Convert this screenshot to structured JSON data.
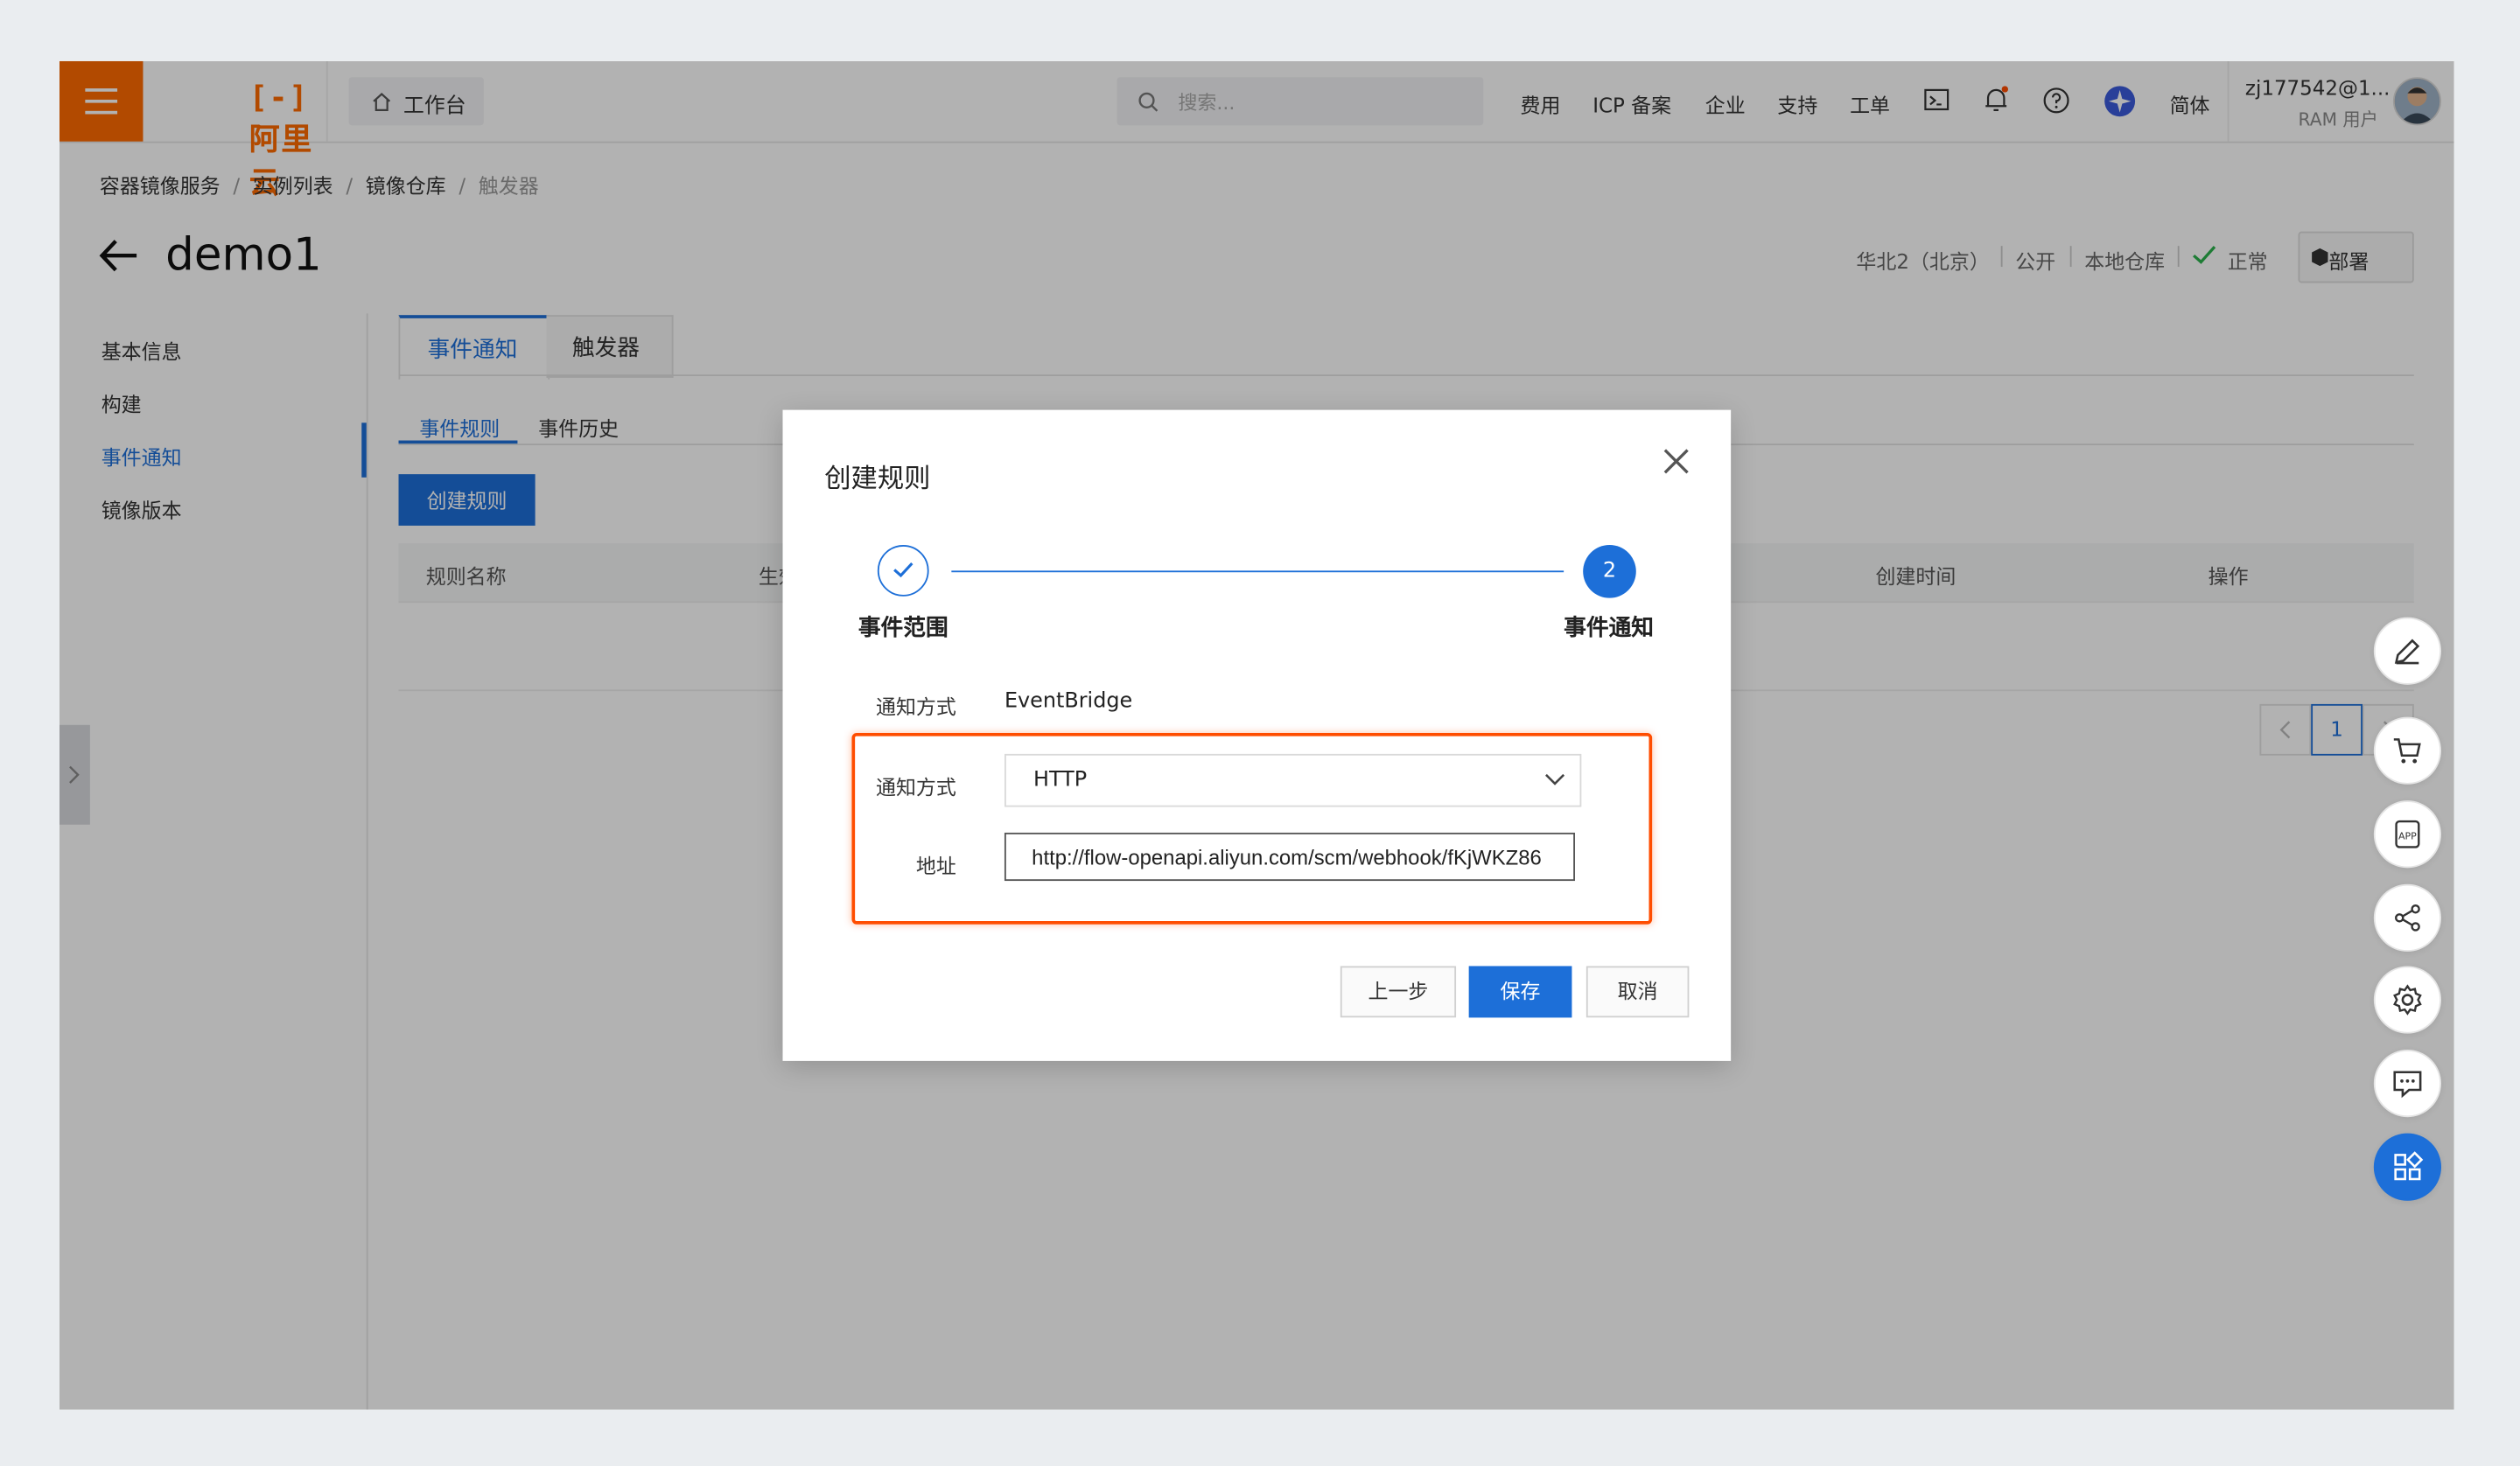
{
  "topbar": {
    "brand": "阿里云",
    "workbench": "工作台",
    "search_placeholder": "搜索...",
    "nav": [
      "费用",
      "ICP 备案",
      "企业",
      "支持",
      "工单"
    ],
    "lang": "简体",
    "user_name": "zj177542@1...",
    "user_role": "RAM 用户"
  },
  "breadcrumb": [
    "容器镜像服务",
    "实例列表",
    "镜像仓库",
    "触发器"
  ],
  "page": {
    "title": "demo1",
    "meta": {
      "region": "华北2（北京）",
      "visibility": "公开",
      "repo_type": "本地仓库",
      "status": "正常"
    },
    "deploy_button": "部署"
  },
  "left_nav": {
    "items": [
      "基本信息",
      "构建",
      "事件通知",
      "镜像版本"
    ],
    "active_index": 2
  },
  "tabs": [
    "事件通知",
    "触发器"
  ],
  "sub_tabs": [
    "事件规则",
    "事件历史"
  ],
  "create_rule_button": "创建规则",
  "table": {
    "columns": [
      "规则名称",
      "生效",
      "创建时间",
      "操作"
    ]
  },
  "pagination": {
    "current": "1"
  },
  "modal": {
    "title": "创建规则",
    "steps": [
      {
        "label": "事件范围",
        "state": "done"
      },
      {
        "label": "事件通知",
        "number": "2",
        "state": "active"
      }
    ],
    "notify_method_label": "通知方式",
    "notify_method_value": "EventBridge",
    "channel_label": "通知方式",
    "channel_value": "HTTP",
    "address_label": "地址",
    "address_value": "http://flow-openapi.aliyun.com/scm/webhook/fKjWKZ86",
    "buttons": {
      "prev": "上一步",
      "save": "保存",
      "cancel": "取消"
    }
  },
  "colors": {
    "brand_orange": "#ff6a00",
    "primary_blue": "#1d6fd8",
    "highlight_border": "#ff4d00",
    "status_green": "#2bb24c"
  }
}
